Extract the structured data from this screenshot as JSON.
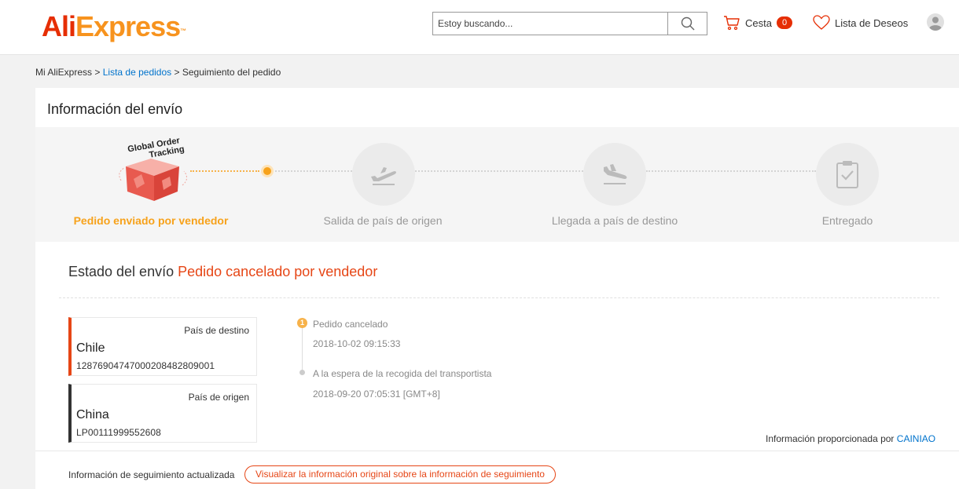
{
  "header": {
    "logo_ali": "Ali",
    "logo_express": "Express",
    "logo_tm": "™",
    "search_placeholder": "Estoy buscando...",
    "cart_label": "Cesta",
    "cart_count": "0",
    "wishlist_label": "Lista de Deseos"
  },
  "breadcrumb": {
    "root": "Mi AliExpress",
    "sep1": ">",
    "orders": "Lista de pedidos",
    "sep2": ">",
    "current": "Seguimiento del pedido"
  },
  "shipping": {
    "title": "Información del envío",
    "badge_line1": "Global Order",
    "badge_line2": "Tracking",
    "steps": [
      {
        "label": "Pedido enviado por vendedor",
        "active": true,
        "icon": "package-box-icon"
      },
      {
        "label": "Salida de país de origen",
        "active": false,
        "icon": "plane-takeoff-icon"
      },
      {
        "label": "Llegada a país de destino",
        "active": false,
        "icon": "plane-landing-icon"
      },
      {
        "label": "Entregado",
        "active": false,
        "icon": "clipboard-check-icon"
      }
    ]
  },
  "status": {
    "label": "Estado del envío",
    "value": "Pedido cancelado por vendedor"
  },
  "destination": {
    "type": "País de destino",
    "country": "Chile",
    "number": "1287690474700020848280900​1"
  },
  "origin": {
    "type": "País de origen",
    "country": "China",
    "number": "LP00111999552608"
  },
  "timeline": [
    {
      "num": "1",
      "event": "Pedido cancelado",
      "time": "2018-10-02 09:15:33"
    },
    {
      "event": "A la espera de la recogida del transportista",
      "time": "2018-09-20 07:05:31 [GMT+8]"
    }
  ],
  "provider": {
    "label": "Información proporcionada por",
    "name": "CAINIAO"
  },
  "footer": {
    "label": "Información de seguimiento actualizada",
    "button": "Visualizar la información original sobre la información de seguimiento"
  },
  "colors": {
    "brand_red": "#e62e04",
    "brand_orange": "#f7931e",
    "active_step": "#f7a21b",
    "status_red": "#e64616",
    "link_blue": "#0073cc"
  }
}
